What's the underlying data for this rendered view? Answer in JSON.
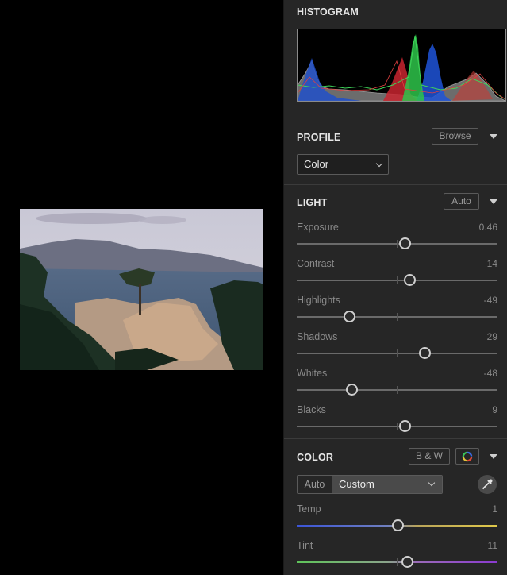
{
  "histogram": {
    "title": "HISTOGRAM"
  },
  "profile": {
    "title": "PROFILE",
    "browse_label": "Browse",
    "selected": "Color"
  },
  "light": {
    "title": "LIGHT",
    "auto_label": "Auto",
    "sliders": [
      {
        "label": "Exposure",
        "value": "0.46",
        "position": 0.54
      },
      {
        "label": "Contrast",
        "value": "14",
        "position": 0.565
      },
      {
        "label": "Highlights",
        "value": "-49",
        "position": 0.265
      },
      {
        "label": "Shadows",
        "value": "29",
        "position": 0.64
      },
      {
        "label": "Whites",
        "value": "-48",
        "position": 0.275
      },
      {
        "label": "Blacks",
        "value": "9",
        "position": 0.54
      }
    ]
  },
  "color": {
    "title": "COLOR",
    "bw_label": "B & W",
    "auto_label": "Auto",
    "mode": "Custom",
    "sliders": [
      {
        "label": "Temp",
        "value": "1",
        "position": 0.505
      },
      {
        "label": "Tint",
        "value": "11",
        "position": 0.555
      }
    ]
  }
}
